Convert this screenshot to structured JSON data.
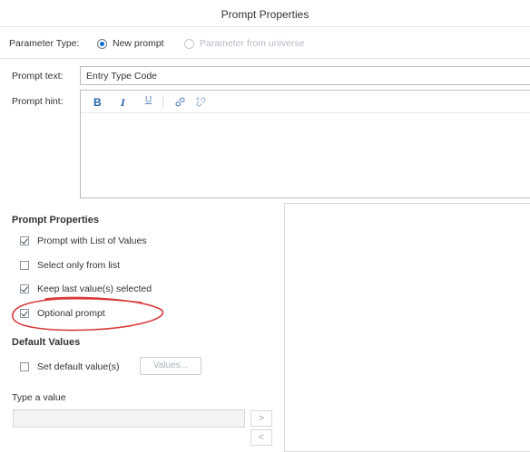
{
  "dialog": {
    "title": "Prompt Properties"
  },
  "parameter_type": {
    "label": "Parameter Type:",
    "options": [
      {
        "label": "New prompt",
        "selected": true
      },
      {
        "label": "Parameter from universe",
        "selected": false
      }
    ]
  },
  "prompt_text": {
    "label": "Prompt text:",
    "value": "Entry Type Code"
  },
  "prompt_hint": {
    "label": "Prompt hint:",
    "toolbar": {
      "bold": "B",
      "italic": "I",
      "underline": "U"
    }
  },
  "properties": {
    "heading": "Prompt Properties",
    "items": [
      {
        "label": "Prompt with List of Values",
        "checked": true
      },
      {
        "label": "Select only from list",
        "checked": false
      },
      {
        "label": "Keep last value(s) selected",
        "checked": true
      },
      {
        "label": "Optional prompt",
        "checked": true
      }
    ]
  },
  "default_values": {
    "heading": "Default Values",
    "set_label": "Set default value(s)",
    "checked": false,
    "values_button": "Values..."
  },
  "type_value": {
    "label": "Type a value",
    "add_button": ">",
    "remove_button": "<"
  },
  "colors": {
    "accent": "#0a6ed1",
    "annotation": "#d93a3a"
  }
}
